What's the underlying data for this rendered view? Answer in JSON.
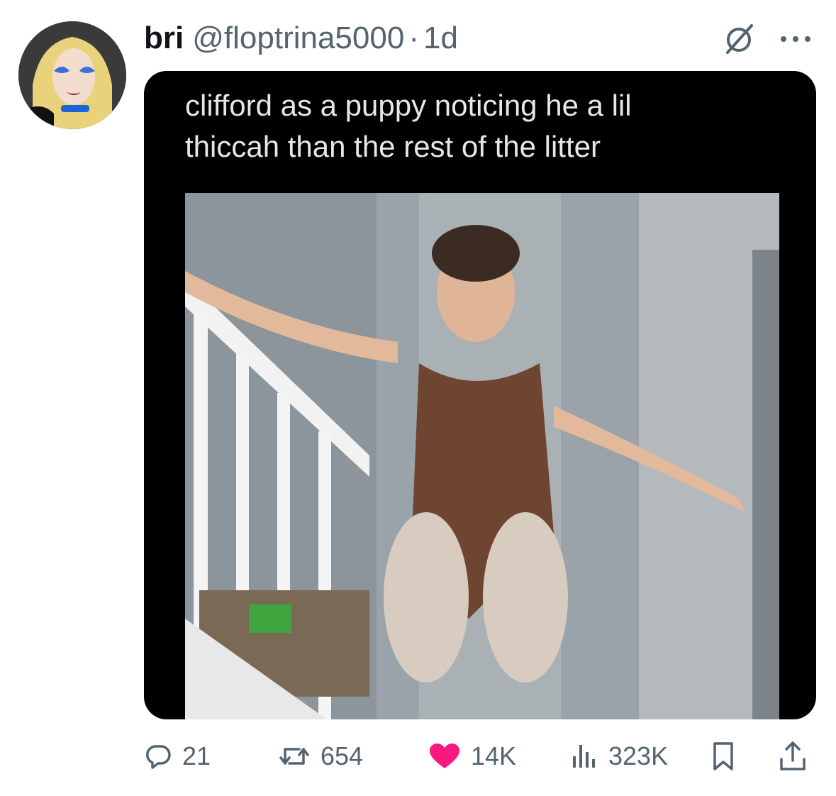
{
  "tweet": {
    "display_name": "bri",
    "handle": "@floptrina5000",
    "separator": "·",
    "time": "1d",
    "caption_lines": [
      "clifford as a puppy noticing he a lil",
      "thiccah than the rest of the litter"
    ]
  },
  "metrics": {
    "replies": "21",
    "reposts": "654",
    "likes": "14K",
    "views": "323K"
  },
  "icons": {
    "avatar": "profile-avatar",
    "grok": "grok-icon",
    "more": "more-dots-icon",
    "reply": "reply-bubble-icon",
    "repost": "repost-arrows-icon",
    "like": "heart-icon",
    "views": "views-bars-icon",
    "bookmark": "bookmark-icon",
    "share": "share-icon"
  },
  "colors": {
    "text_primary": "#0f1419",
    "text_secondary": "#536471",
    "like_active": "#f91880",
    "media_background": "#000000"
  }
}
